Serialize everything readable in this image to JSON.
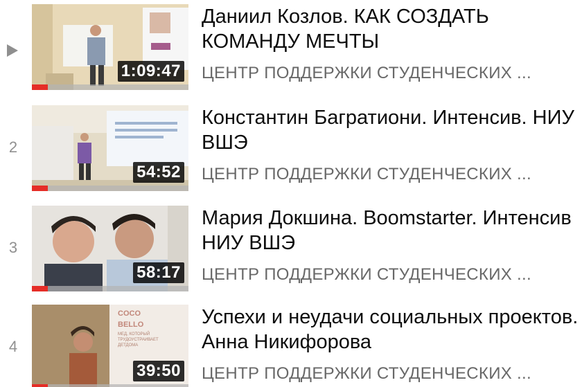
{
  "playlist": {
    "items": [
      {
        "index": "",
        "now_playing": true,
        "title": "Даниил Козлов. КАК СОЗДАТЬ КОМАНДУ МЕЧТЫ",
        "channel": "ЦЕНТР ПОДДЕРЖКИ СТУДЕНЧЕСКИХ ...",
        "duration": "1:09:47",
        "watched_fraction": 0.1,
        "thumbnail_icon": "lecture-speaker-thumbnail"
      },
      {
        "index": "2",
        "now_playing": false,
        "title": "Константин Багратиони. Интенсив. НИУ ВШЭ",
        "channel": "ЦЕНТР ПОДДЕРЖКИ СТУДЕНЧЕСКИХ ...",
        "duration": "54:52",
        "watched_fraction": 0.1,
        "thumbnail_icon": "lecture-presentation-thumbnail"
      },
      {
        "index": "3",
        "now_playing": false,
        "title": "Мария Докшина. Boomstarter. Интенсив НИУ ВШЭ",
        "channel": "ЦЕНТР ПОДДЕРЖКИ СТУДЕНЧЕСКИХ ...",
        "duration": "58:17",
        "watched_fraction": 0.1,
        "thumbnail_icon": "audience-faces-thumbnail"
      },
      {
        "index": "4",
        "now_playing": false,
        "title": "Успехи и неудачи социальных проектов. Анна Никифорова",
        "channel": "ЦЕНТР ПОДДЕРЖКИ СТУДЕНЧЕСКИХ ...",
        "duration": "39:50",
        "watched_fraction": 0.1,
        "thumbnail_icon": "speaker-slide-thumbnail",
        "thumbnail_text": [
          "COCO",
          "BELLO",
          "МЕД, КОТОРЫЙ",
          "ТРУДОУСТРАИВАЕТ",
          "ДЕТДОМА"
        ]
      }
    ]
  },
  "colors": {
    "progress_fill": "#e52d27",
    "title_text": "#0d0d0d",
    "channel_text": "#686868",
    "index_text": "#909090"
  }
}
